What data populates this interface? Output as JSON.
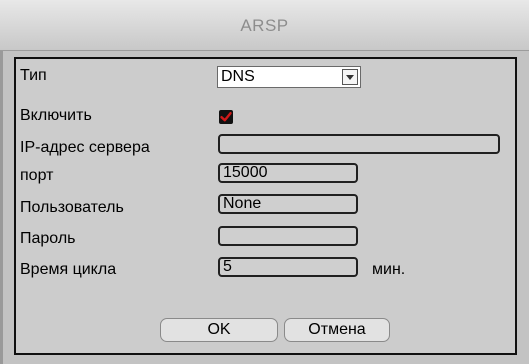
{
  "window": {
    "title": "ARSP"
  },
  "form": {
    "type_label": "Тип",
    "type_value": "DNS",
    "enable_label": "Включить",
    "enable_checked": true,
    "server_ip_label": "IP-адрес сервера",
    "server_ip_value": "",
    "port_label": "порт",
    "port_value": "15000",
    "user_label": "Пользователь",
    "user_value": "None",
    "password_label": "Пароль",
    "password_value": "",
    "cycle_label": "Время цикла",
    "cycle_value": "5",
    "cycle_unit": "мин."
  },
  "buttons": {
    "ok_label": "OK",
    "cancel_label": "Отмена"
  },
  "colors": {
    "checkbox_check": "#d11a1a",
    "panel_border": "#101010"
  },
  "icons": {
    "dropdown": "chevron-down-icon",
    "check": "check-icon"
  }
}
